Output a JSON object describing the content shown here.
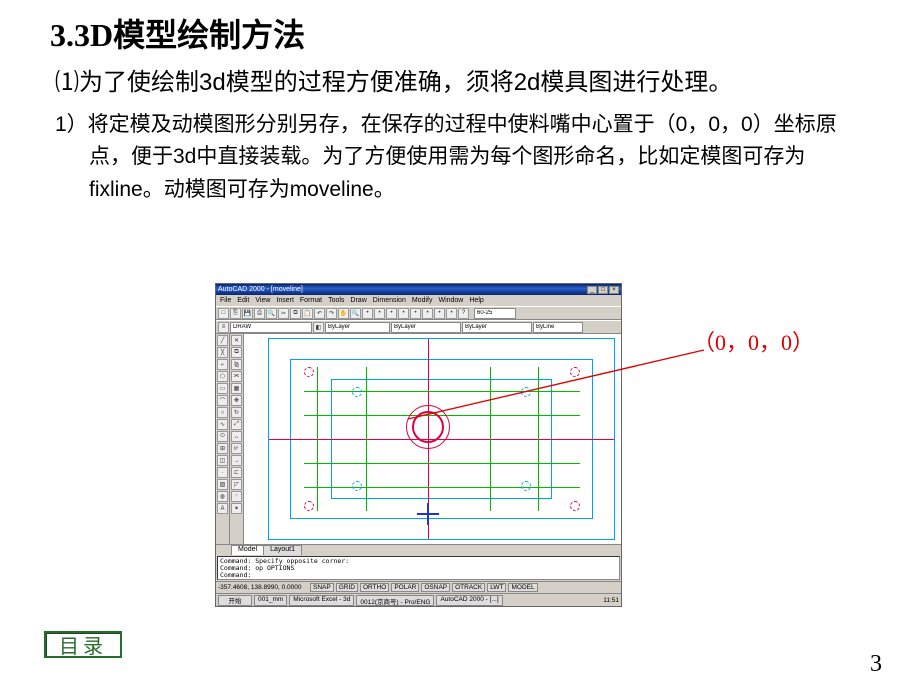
{
  "title": "3.3D模型绘制方法",
  "para1": "⑴为了使绘制3d模型的过程方便准确，须将2d模具图进行处理。",
  "para2": "1）将定模及动模图形分别另存，在保存的过程中使料嘴中心置于（0，0，0）坐标原点，便于3d中直接装载。为了方便使用需为每个图形命名，比如定模图可存为fixline。动模图可存为moveline。",
  "annotation": "（0，0，0）",
  "toc_label": "目录",
  "page_number": "3",
  "autocad": {
    "titlebar": "AutoCAD 2000 - [moveline]",
    "menus": [
      "File",
      "Edit",
      "View",
      "Insert",
      "Format",
      "Tools",
      "Draw",
      "Dimension",
      "Modify",
      "Window",
      "Help"
    ],
    "layer_dropdown": "DRAW",
    "linetype1": "ByLayer",
    "linetype2": "ByLayer",
    "linetype3": "ByLayer",
    "input_value": "60-25",
    "tabs": [
      "Model",
      "Layout1"
    ],
    "command_lines": "Command:  Specify opposite corner:\nCommand: op OPTIONS\nCommand:",
    "coords": "-357.4608, 138.8990, 0.0000",
    "status_buttons": [
      "SNAP",
      "GRID",
      "ORTHO",
      "POLAR",
      "OSNAP",
      "OTRACK",
      "LWT",
      "MODEL"
    ],
    "taskbar": {
      "start": "开始",
      "tasks": [
        "001_mm",
        "Microsoft Excel - 3d",
        "0012(京商号) - Pro/ENG",
        "AutoCAD 2000 - [...]"
      ],
      "time": "11:51"
    }
  }
}
